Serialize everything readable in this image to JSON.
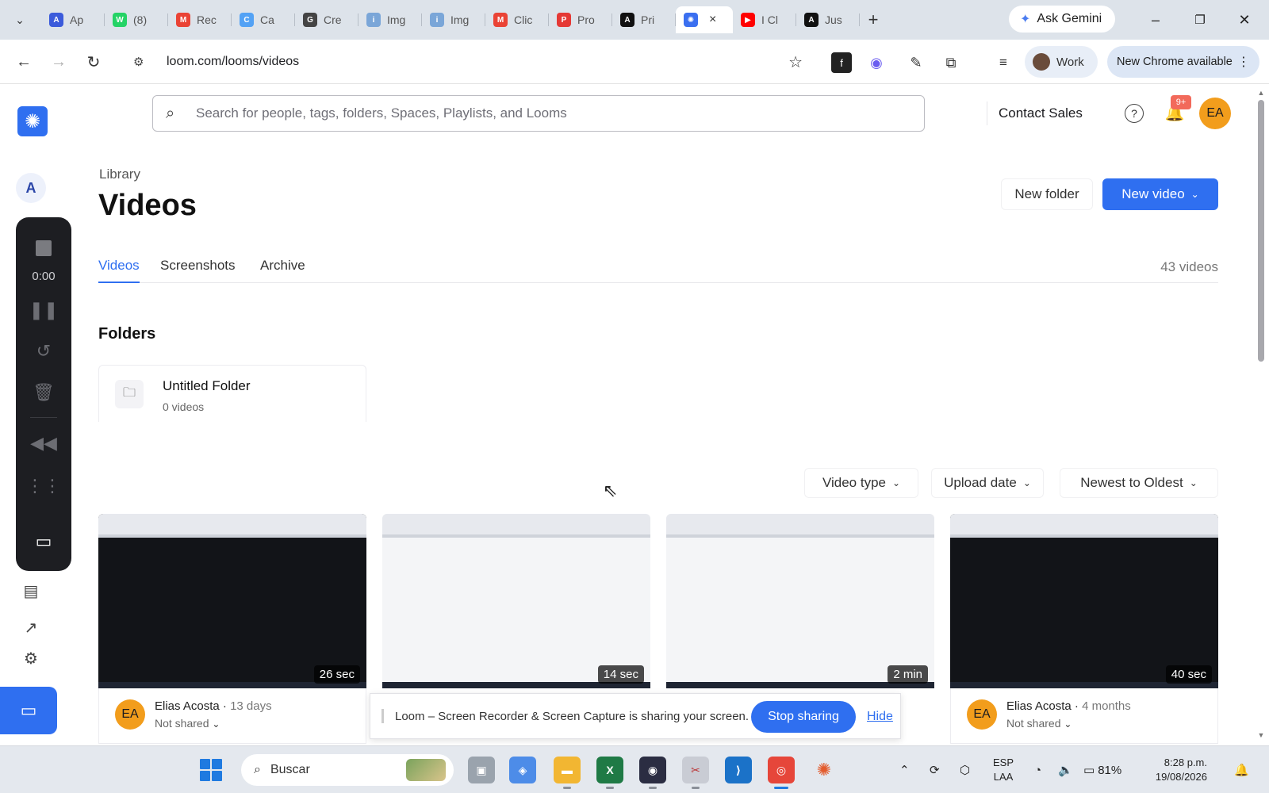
{
  "browser": {
    "tabs": [
      {
        "label": "Ap",
        "color": "#3b5bdb",
        "glyph": "A"
      },
      {
        "label": "(8)",
        "color": "#25d366",
        "glyph": "W"
      },
      {
        "label": "Rec",
        "color": "#ea4335",
        "glyph": "M"
      },
      {
        "label": "Ca",
        "color": "#53a2f5",
        "glyph": "C"
      },
      {
        "label": "Cre",
        "color": "#444444",
        "glyph": "G"
      },
      {
        "label": "Img",
        "color": "#7aa6d8",
        "glyph": "i"
      },
      {
        "label": "Img",
        "color": "#7aa6d8",
        "glyph": "i"
      },
      {
        "label": "Clic",
        "color": "#ea4335",
        "glyph": "M"
      },
      {
        "label": "Pro",
        "color": "#e53935",
        "glyph": "P"
      },
      {
        "label": "Pri",
        "color": "#111111",
        "glyph": "A"
      },
      {
        "label": "I Cl",
        "color": "#ff0000",
        "glyph": "▶"
      },
      {
        "label": "Jus",
        "color": "#111111",
        "glyph": "A"
      }
    ],
    "active_tab_close": "×",
    "new_tab": "+",
    "ask_gemini": "Ask Gemini",
    "url": "loom.com/looms/videos",
    "profile_label": "Work",
    "chrome_update": "New Chrome available"
  },
  "loom": {
    "workspace_initial": "A",
    "recorder_timer": "0:00",
    "search_placeholder": "Search for people, tags, folders, Spaces, Playlists, and Looms",
    "contact_sales": "Contact Sales",
    "notification_badge": "9+",
    "avatar_initials": "EA",
    "breadcrumb": "Library",
    "page_title": "Videos",
    "new_folder": "New folder",
    "new_video": "New video",
    "tabs": [
      "Videos",
      "Screenshots",
      "Archive"
    ],
    "video_count": "43 videos",
    "folders_heading": "Folders",
    "folder": {
      "name": "Untitled Folder",
      "count": "0 videos"
    },
    "filters": [
      "Video type",
      "Upload date",
      "Newest to Oldest"
    ],
    "videos": [
      {
        "duration": "26 sec",
        "author": "Elias Acosta",
        "age": "13 days",
        "sharing": "Not shared",
        "theme": "dark"
      },
      {
        "duration": "14 sec",
        "author": "",
        "age": "",
        "sharing": "",
        "theme": "light"
      },
      {
        "duration": "2 min",
        "author": "",
        "age": "",
        "sharing": "",
        "theme": "light"
      },
      {
        "duration": "40 sec",
        "author": "Elias Acosta",
        "age": "4 months",
        "sharing": "Not shared",
        "theme": "dark"
      }
    ],
    "share_bar": {
      "message": "Loom – Screen Recorder & Screen Capture is sharing your screen.",
      "stop": "Stop sharing",
      "hide": "Hide"
    }
  },
  "taskbar": {
    "search_label": "Buscar",
    "language_top": "ESP",
    "language_bottom": "LAA",
    "battery": "81%",
    "time": "8:28 p.m.",
    "date": "19/08/2026"
  }
}
